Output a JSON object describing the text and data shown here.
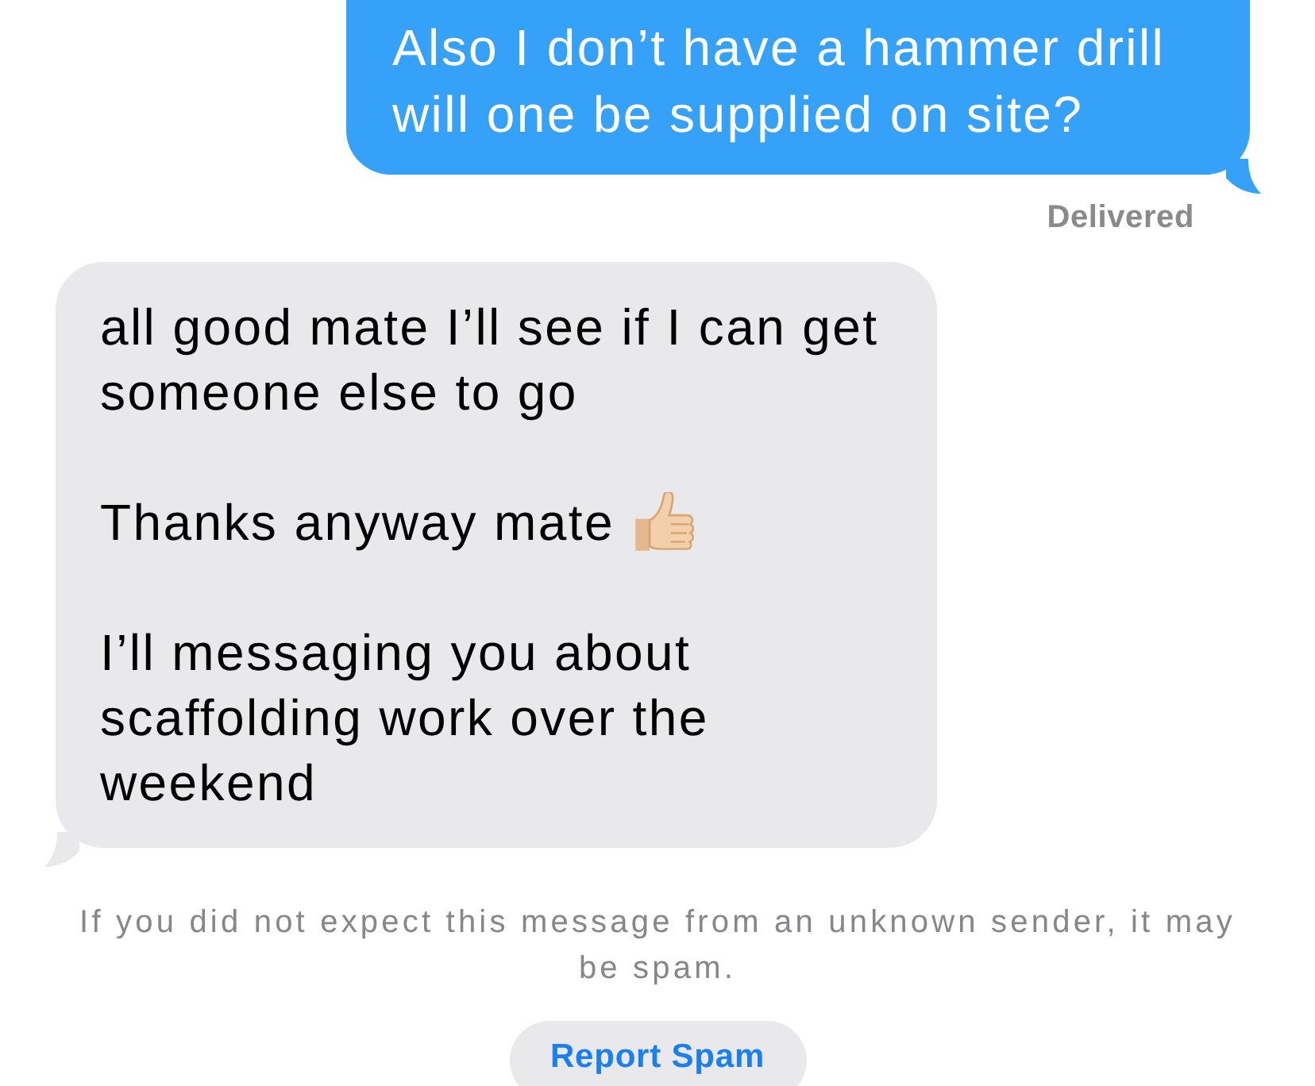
{
  "messages": [
    {
      "kind": "outgoing",
      "paragraphs": [
        {
          "text": "Also I don’t have a hammer drill will one be supplied on site?",
          "emoji": false
        }
      ],
      "status": "Delivered"
    },
    {
      "kind": "incoming",
      "paragraphs": [
        {
          "text": "all good mate I’ll see if I can get someone else to go",
          "emoji": false
        },
        {
          "text": "Thanks anyway mate",
          "emoji": true
        },
        {
          "text": "I’ll messaging you about scaffolding work over the weekend",
          "emoji": false
        }
      ]
    }
  ],
  "spam_notice": {
    "text": "If you did not expect this message from an unknown sender, it may be spam.",
    "button": "Report Spam"
  }
}
